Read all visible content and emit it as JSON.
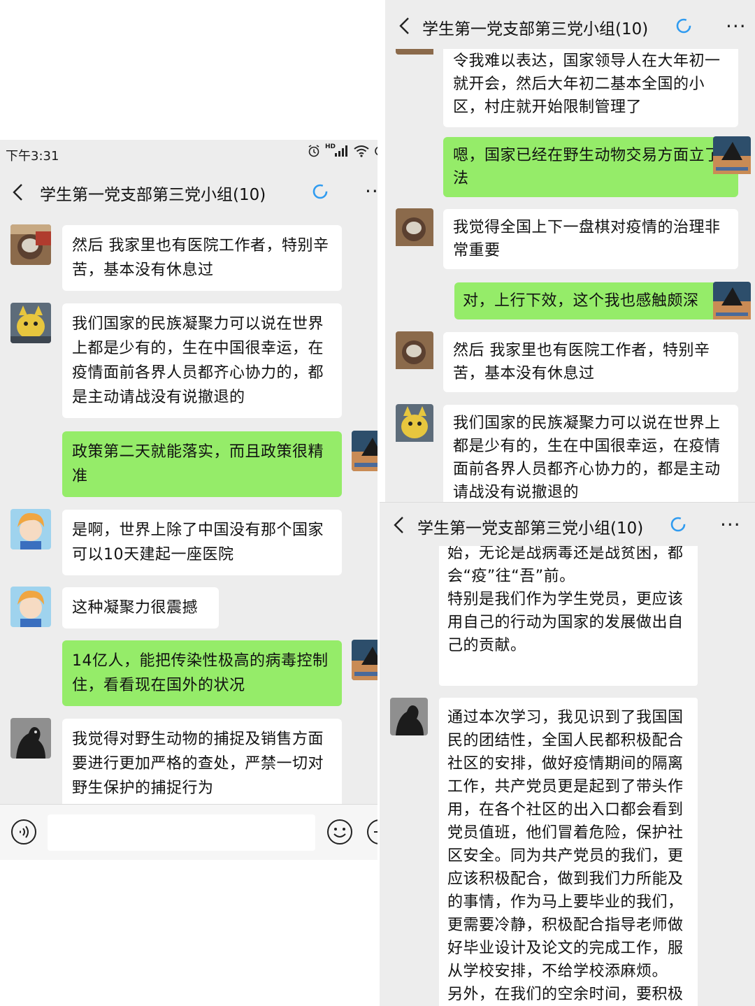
{
  "chat": {
    "title": "学生第一党支部第三党小组(10)"
  },
  "left": {
    "status_time": "下午3:31",
    "status_hd": "HD",
    "messages": [
      {
        "side": "in",
        "text": "然后 我家里也有医院工作者，特别辛苦，基本没有休息过"
      },
      {
        "side": "in",
        "text": "我们国家的民族凝聚力可以说在世界上都是少有的，生在中国很幸运，在疫情面前各界人员都齐心协力的，都是主动请战没有说撤退的"
      },
      {
        "side": "out",
        "text": "政策第二天就能落实，而且政策很精准"
      },
      {
        "side": "in",
        "text": "是啊，世界上除了中国没有那个国家可以10天建起一座医院"
      },
      {
        "side": "in",
        "text": "这种凝聚力很震撼"
      },
      {
        "side": "out",
        "text": "14亿人，能把传染性极高的病毒控制住，看看现在国外的状况"
      },
      {
        "side": "in",
        "text": "我觉得对野生动物的捕捉及销售方面要进行更加严格的查处，严禁一切对野生保护的捕捉行为"
      }
    ]
  },
  "top_right": {
    "messages": [
      {
        "side": "in",
        "text": "令我难以表达，国家领导人在大年初一就开会，然后大年初二基本全国的小区，村庄就开始限制管理了"
      },
      {
        "side": "out",
        "text": "嗯，国家已经在野生动物交易方面立了法"
      },
      {
        "side": "in",
        "text": "我觉得全国上下一盘棋对疫情的治理非常重要"
      },
      {
        "side": "out",
        "text": "对，上行下效，这个我也感触颇深"
      },
      {
        "side": "in",
        "text": "然后 我家里也有医院工作者，特别辛苦，基本没有休息过"
      },
      {
        "side": "in",
        "text": "我们国家的民族凝聚力可以说在世界上都是少有的，生在中国很幸运，在疫情面前各界人员都齐心协力的，都是主动请战没有说撤退的"
      }
    ]
  },
  "bottom_right": {
    "first_message": "始，无论是战病毒还是战贫困，都会“疫”往“吾”前。\n特别是我们作为学生党员，更应该用自己的行动为国家的发展做出自己的贡献。",
    "second_message": "通过本次学习，我见识到了我国国民的团结性，全国人民都积极配合社区的安排，做好疫情期间的隔离工作，共产党员更是起到了带头作用，在各个社区的出入口都会看到党员值班，他们冒着危险，保护社区安全。同为共产党员的我们，更应该积极配合，做到我们力所能及的事情，作为马上要毕业的我们，更需要冷静，积极配合指导老师做好毕业设计及论文的完成工作，服从学校安排，不给学校添麻烦。\n另外，在我们的空余时间，要积极参"
  },
  "icons": {
    "back": "back-chevron-icon",
    "loading": "loading-ring-icon",
    "more": "more-dots-icon",
    "voice": "voice-icon",
    "emoji": "emoji-icon",
    "plus": "plus-icon"
  },
  "colors": {
    "chat_bg": "#ededed",
    "incoming_bubble": "#ffffff",
    "outgoing_bubble": "#95ec69",
    "loading_ring": "#2f9bf0"
  }
}
